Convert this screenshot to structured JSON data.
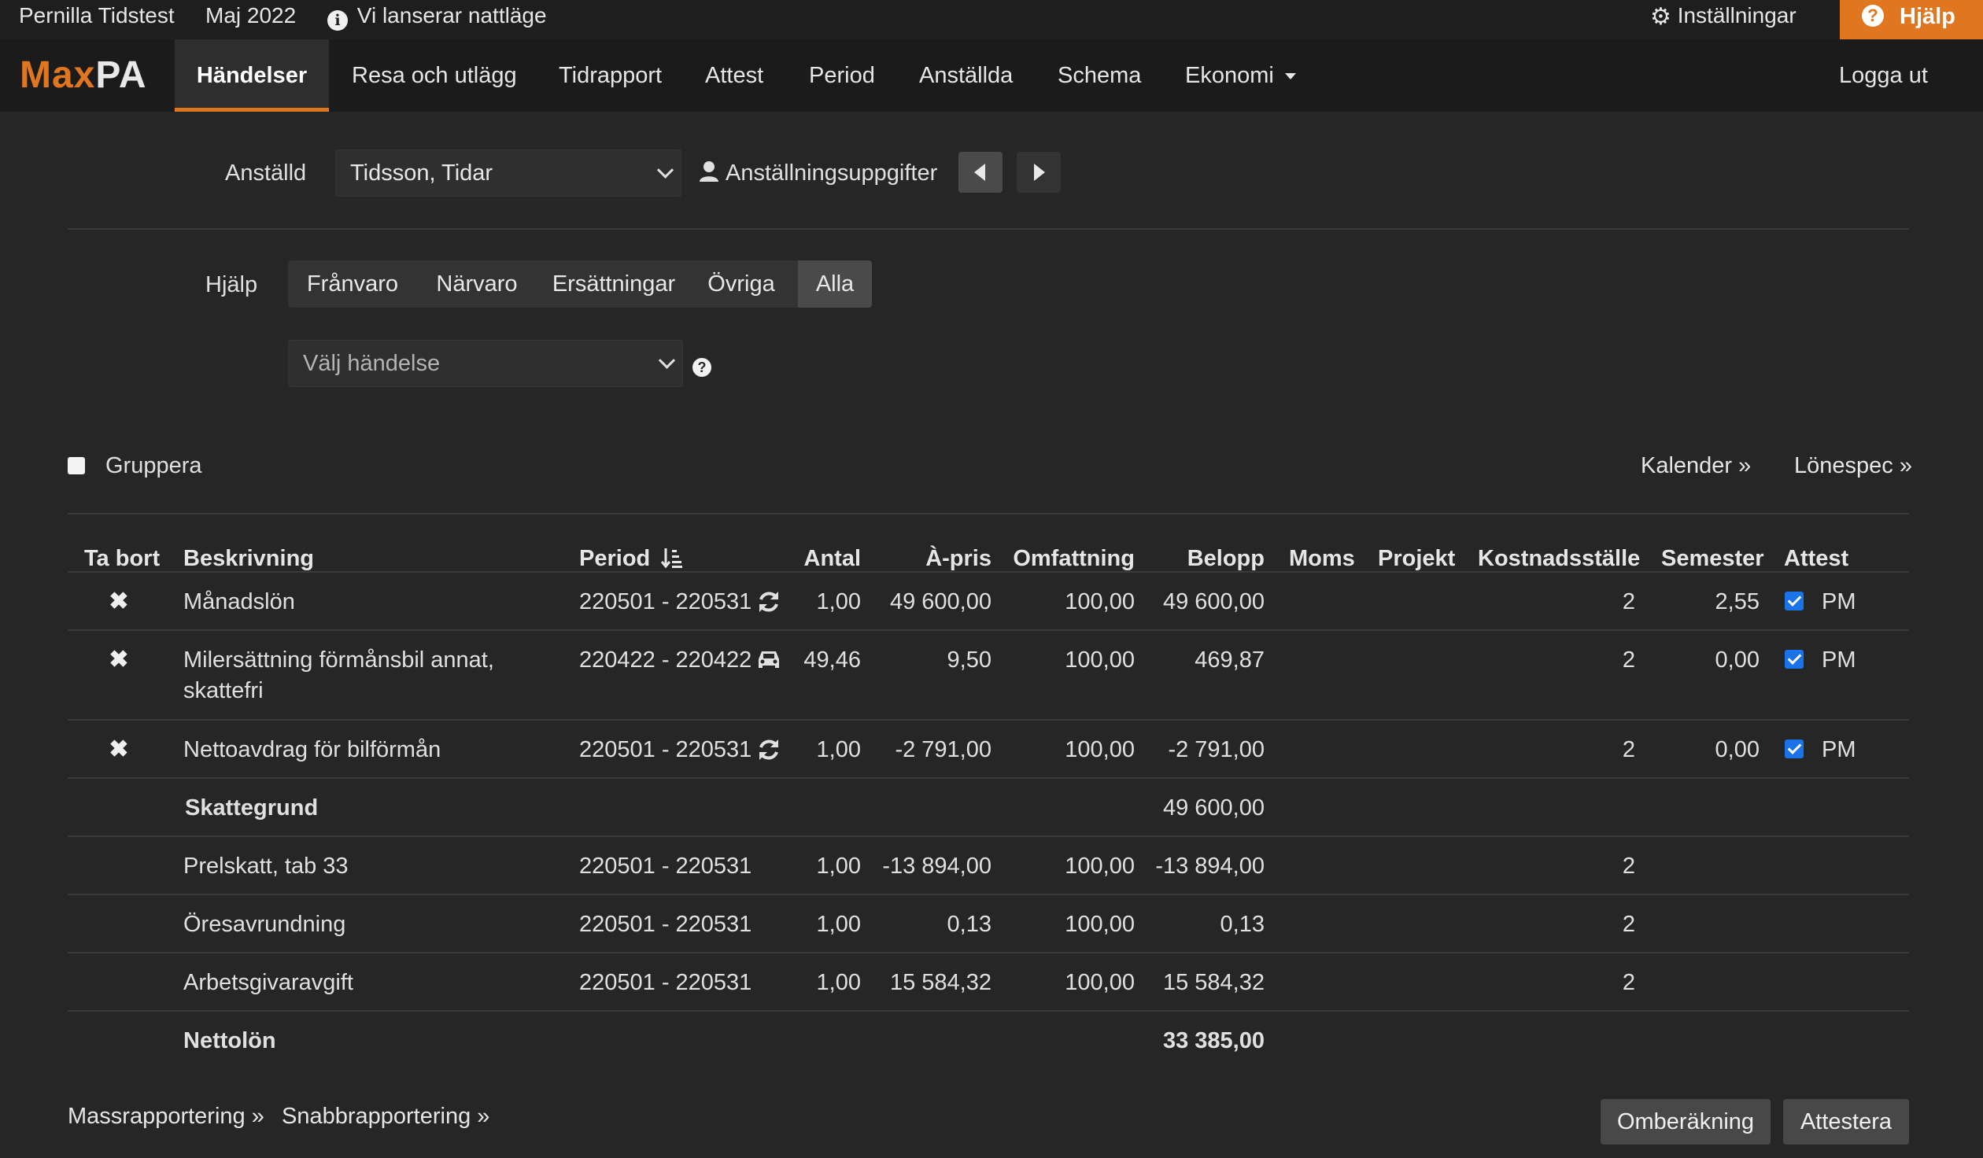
{
  "topbar": {
    "user": "Pernilla Tidstest",
    "period": "Maj 2022",
    "notice": "Vi lanserar nattläge",
    "settings": "Inställningar",
    "help": "Hjälp"
  },
  "logo": {
    "part1": "Max",
    "part2": "PA"
  },
  "nav": {
    "items": [
      "Händelser",
      "Resa och utlägg",
      "Tidrapport",
      "Attest",
      "Period",
      "Anställda",
      "Schema",
      "Ekonomi"
    ],
    "logout": "Logga ut"
  },
  "employee": {
    "label": "Anställd",
    "selected": "Tidsson, Tidar",
    "details_link": "Anställningsuppgifter"
  },
  "filter": {
    "label": "Hjälp",
    "tabs": [
      "Frånvaro",
      "Närvaro",
      "Ersättningar",
      "Övriga",
      "Alla"
    ],
    "active": "Alla",
    "event_placeholder": "Välj händelse"
  },
  "group_label": "Gruppera",
  "links": {
    "calendar": "Kalender »",
    "payslip": "Lönespec »",
    "mass": "Massrapportering »",
    "quick": "Snabbrapportering »"
  },
  "table": {
    "headers": [
      "Ta bort",
      "Beskrivning",
      "Period",
      "Antal",
      "À-pris",
      "Omfattning",
      "Belopp",
      "Moms",
      "Projekt",
      "Kostnadsställe",
      "Semester",
      "Attest"
    ],
    "rows": [
      {
        "desc": "Månadslön",
        "period": "220501 - 220531",
        "antal": "1,00",
        "apris": "49 600,00",
        "omf": "100,00",
        "belopp": "49 600,00",
        "kst": "2",
        "sem": "2,55",
        "attest": "PM",
        "icon": "refresh-icon"
      },
      {
        "desc": "Milersättning förmånsbil annat,",
        "desc2": "skattefri",
        "period": "220422 - 220422",
        "antal": "49,46",
        "apris": "9,50",
        "omf": "100,00",
        "belopp": "469,87",
        "kst": "2",
        "sem": "0,00",
        "attest": "PM",
        "icon": "car-icon"
      },
      {
        "desc": "Nettoavdrag för bilförmån",
        "period": "220501 - 220531",
        "antal": "1,00",
        "apris": "-2 791,00",
        "omf": "100,00",
        "belopp": "-2 791,00",
        "kst": "2",
        "sem": "0,00",
        "attest": "PM",
        "icon": "refresh-icon"
      },
      {
        "desc": "Skattegrund",
        "belopp": "49 600,00"
      },
      {
        "desc": "Prelskatt, tab 33",
        "period": "220501 - 220531",
        "antal": "1,00",
        "apris": "-13 894,00",
        "omf": "100,00",
        "belopp": "-13 894,00",
        "kst": "2"
      },
      {
        "desc": "Öresavrundning",
        "period": "220501 - 220531",
        "antal": "1,00",
        "apris": "0,13",
        "omf": "100,00",
        "belopp": "0,13",
        "kst": "2"
      },
      {
        "desc": "Arbetsgivaravgift",
        "period": "220501 - 220531",
        "antal": "1,00",
        "apris": "15 584,32",
        "omf": "100,00",
        "belopp": "15 584,32",
        "kst": "2"
      },
      {
        "desc": "Nettolön",
        "belopp": "33 385,00"
      }
    ]
  },
  "buttons": {
    "recalc": "Omberäkning",
    "approve": "Attestera"
  },
  "colors": {
    "accent": "#e0761f",
    "checkbox": "#1a73e8"
  }
}
